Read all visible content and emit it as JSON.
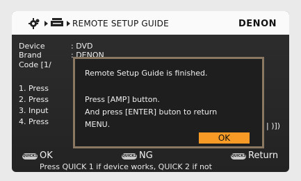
{
  "header": {
    "title": "REMOTE SETUP GUIDE",
    "brand": "DENON",
    "breadcrumb_icons": [
      "gear-icon",
      "device-icon"
    ]
  },
  "info": {
    "device_label": "Device",
    "device_value": ": DVD",
    "brand_label": "Brand",
    "brand_value": ": DENON",
    "code_label": "Code [1/",
    "steps": [
      "1. Press",
      "2. Press",
      "3. Input",
      "4. Press"
    ],
    "step4_tail": "| )])"
  },
  "dialog": {
    "line1": "Remote Setup Guide is finished.",
    "line2": "Press [AMP] button.",
    "line3": "And press [ENTER] buton to return",
    "line4": "MENU.",
    "ok_label": "OK"
  },
  "footer": {
    "quick1_tag": "QUICK1",
    "quick1_label": "OK",
    "quick2_tag": "QUICK2",
    "quick2_label": "NG",
    "quick3_tag": "QUICK3",
    "quick3_label": "Return",
    "hint": "Press QUICK 1 if device works, QUICK 2 if not"
  },
  "colors": {
    "screen_bg": "#2a2a2a",
    "header_bg": "#fafafa",
    "dialog_border": "#8a7862",
    "ok_button": "#f79a26"
  }
}
